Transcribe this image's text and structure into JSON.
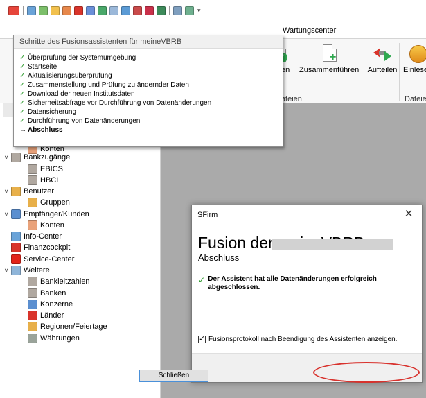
{
  "ribbon": {
    "tab_wartung": "Wartungscenter",
    "buttons": {
      "pruefen": "Prüfen",
      "zusammenfuehren": "Zusammenführen",
      "aufteilen": "Aufteilen",
      "einlesen": "Einlesen"
    },
    "groups": {
      "dateien": "Dateien",
      "dateien2": "Dateien"
    }
  },
  "popup": {
    "title": "Schritte des Fusionsassistenten für meineVBRB",
    "steps": [
      {
        "label": "Überprüfung der Systemumgebung",
        "done": true
      },
      {
        "label": "Startseite",
        "done": true
      },
      {
        "label": "Aktualisierungsüberprüfung",
        "done": true
      },
      {
        "label": "Zusammenstellung und Prüfung zu ändernder Daten",
        "done": true
      },
      {
        "label": "Download der neuen Institutsdaten",
        "done": true
      },
      {
        "label": "Sicherheitsabfrage vor Durchführung von Datenänderungen",
        "done": true
      },
      {
        "label": "Datensicherung",
        "done": true
      },
      {
        "label": "Durchführung von Datenänderungen",
        "done": true
      },
      {
        "label": "Abschluss",
        "done": false,
        "current": true
      }
    ],
    "done_mark": "✓",
    "current_mark": "→"
  },
  "tree": {
    "partial_item": "Konten",
    "bankzugaenge": "Bankzugänge",
    "ebics": "EBICS",
    "hbci": "HBCI",
    "benutzer": "Benutzer",
    "gruppen": "Gruppen",
    "empfaenger": "Empfänger/Kunden",
    "konten": "Konten",
    "info_center": "Info-Center",
    "finanzcockpit": "Finanzcockpit",
    "service_center": "Service-Center",
    "weitere": "Weitere",
    "bankleitzahlen": "Bankleitzahlen",
    "banken": "Banken",
    "konzerne": "Konzerne",
    "laender": "Länder",
    "regionen": "Regionen/Feiertage",
    "waehrungen": "Währungen"
  },
  "dialog": {
    "title": "SFirm",
    "close_glyph": "✕",
    "heading": "Fusion der meineVBRB",
    "subheading": "Abschluss",
    "message": "Der Assistent hat alle Datenänderungen erfolgreich abgeschlossen.",
    "checkbox_label": "Fusionsprotokoll nach Beendigung des Assistenten anzeigen.",
    "checkbox_checked": true,
    "close_button": "Schließen"
  },
  "colors": {
    "check_green": "#2e9b2e",
    "highlight_red": "#d8322d",
    "workspace_gray": "#aaaaaa"
  }
}
